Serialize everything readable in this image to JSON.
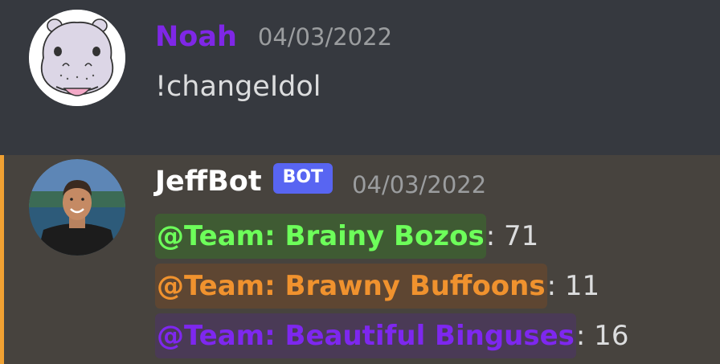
{
  "messages": [
    {
      "username": "Noah",
      "timestamp": "04/03/2022",
      "content": "!changeIdol",
      "avatar_icon": "hippo-avatar",
      "username_color": "#7f27e6"
    },
    {
      "username": "JeffBot",
      "bot_tag": "BOT",
      "timestamp": "04/03/2022",
      "avatar_icon": "person-avatar",
      "highlight_color": "#f0a132",
      "lines": [
        {
          "mention": "@Team: Brainy Bozos",
          "count": ": 71",
          "color": "#6dff5a",
          "bg": "#3f5b33"
        },
        {
          "mention": "@Team: Brawny Buffoons",
          "count": ": 11",
          "color": "#f0922e",
          "bg": "#5e4632"
        },
        {
          "mention": "@Team: Beautiful Binguses",
          "count": ": 16",
          "color": "#7e27ef",
          "bg": "#4a3a56"
        }
      ]
    }
  ]
}
